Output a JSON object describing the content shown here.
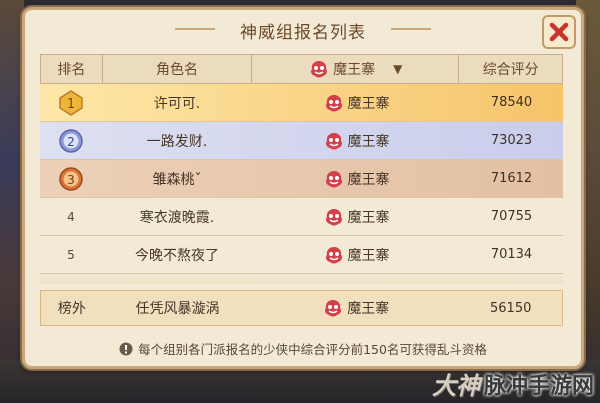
{
  "dialog": {
    "title": "神威组报名列表"
  },
  "header": {
    "rank": "排名",
    "role": "角色名",
    "clan": "魔王寨",
    "score": "综合评分"
  },
  "rows": [
    {
      "rank": "1",
      "name": "许可可.",
      "clan": "魔王寨",
      "score": "78540"
    },
    {
      "rank": "2",
      "name": "一路发财.",
      "clan": "魔王寨",
      "score": "73023"
    },
    {
      "rank": "3",
      "name": "雏森桃ˇ",
      "clan": "魔王寨",
      "score": "71612"
    },
    {
      "rank": "4",
      "name": "寒衣渡晚霞.",
      "clan": "魔王寨",
      "score": "70755"
    },
    {
      "rank": "5",
      "name": "今晚不熬夜了",
      "clan": "魔王寨",
      "score": "70134"
    }
  ],
  "self_row": {
    "rank": "榜外",
    "name": "任凭风暴漩涡",
    "clan": "魔王寨",
    "score": "56150"
  },
  "notice": "每个组别各门派报名的少侠中综合评分前150名可获得乱斗资格",
  "watermark": {
    "logo": "大神",
    "text": "脉冲手游网"
  },
  "colors": {
    "gold_row": "#f6c46a",
    "silver_row": "#c9cdeb",
    "bronze_row": "#e3c0a2",
    "panel": "#f3ead6"
  }
}
